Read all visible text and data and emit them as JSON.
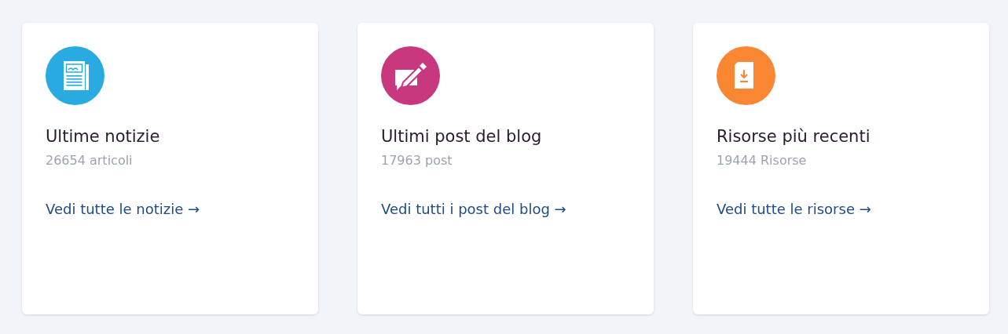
{
  "cards": [
    {
      "kind": "news",
      "color": "#29abe2",
      "title": "Ultime notizie",
      "count": "26654 articoli",
      "link": "Vedi tutte le notizie →"
    },
    {
      "kind": "blog",
      "color": "#c7387e",
      "title": "Ultimi post del blog",
      "count": "17963 post",
      "link": "Vedi tutti i post del blog →"
    },
    {
      "kind": "resource",
      "color": "#f98731",
      "title": "Risorse più recenti",
      "count": "19444 Risorse",
      "link": "Vedi tutte le risorse →"
    }
  ]
}
